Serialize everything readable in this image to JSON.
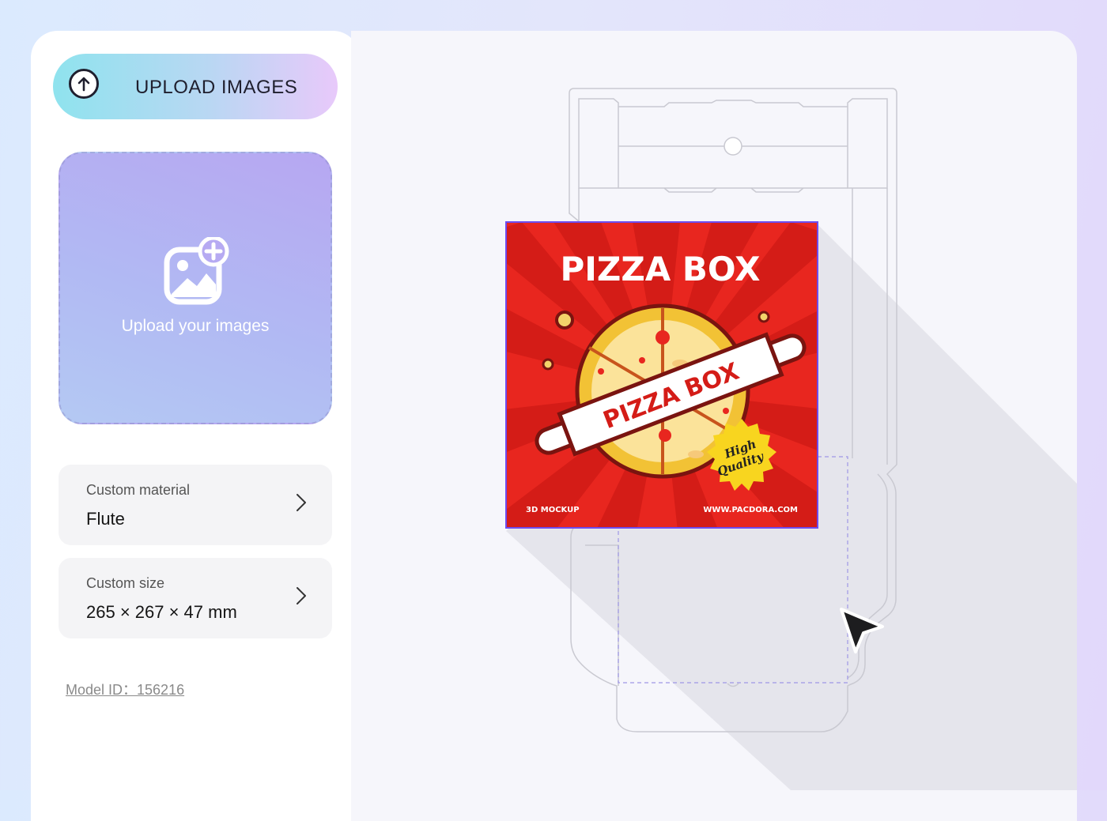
{
  "sidebar": {
    "upload_button": {
      "label": "UPLOAD IMAGES",
      "icon": "arrow-up-circle-icon"
    },
    "dropzone": {
      "label": "Upload your images",
      "icon": "image-add-icon"
    },
    "material": {
      "title": "Custom material",
      "value": "Flute"
    },
    "size": {
      "title": "Custom size",
      "value": "265  ×  267  ×  47 mm"
    },
    "model_id": "Model ID：156216"
  },
  "artwork": {
    "title": "PIZZA BOX",
    "banner": "PIZZA BOX",
    "badge_line1": "High",
    "badge_line2": "Quality",
    "footer_left": "3D MOCKUP",
    "footer_right": "WWW.PACDORA.COM"
  },
  "colors": {
    "artwork_red": "#e8261f",
    "badge_yellow": "#f8d51f",
    "selection_purple": "#6d4cf0"
  }
}
